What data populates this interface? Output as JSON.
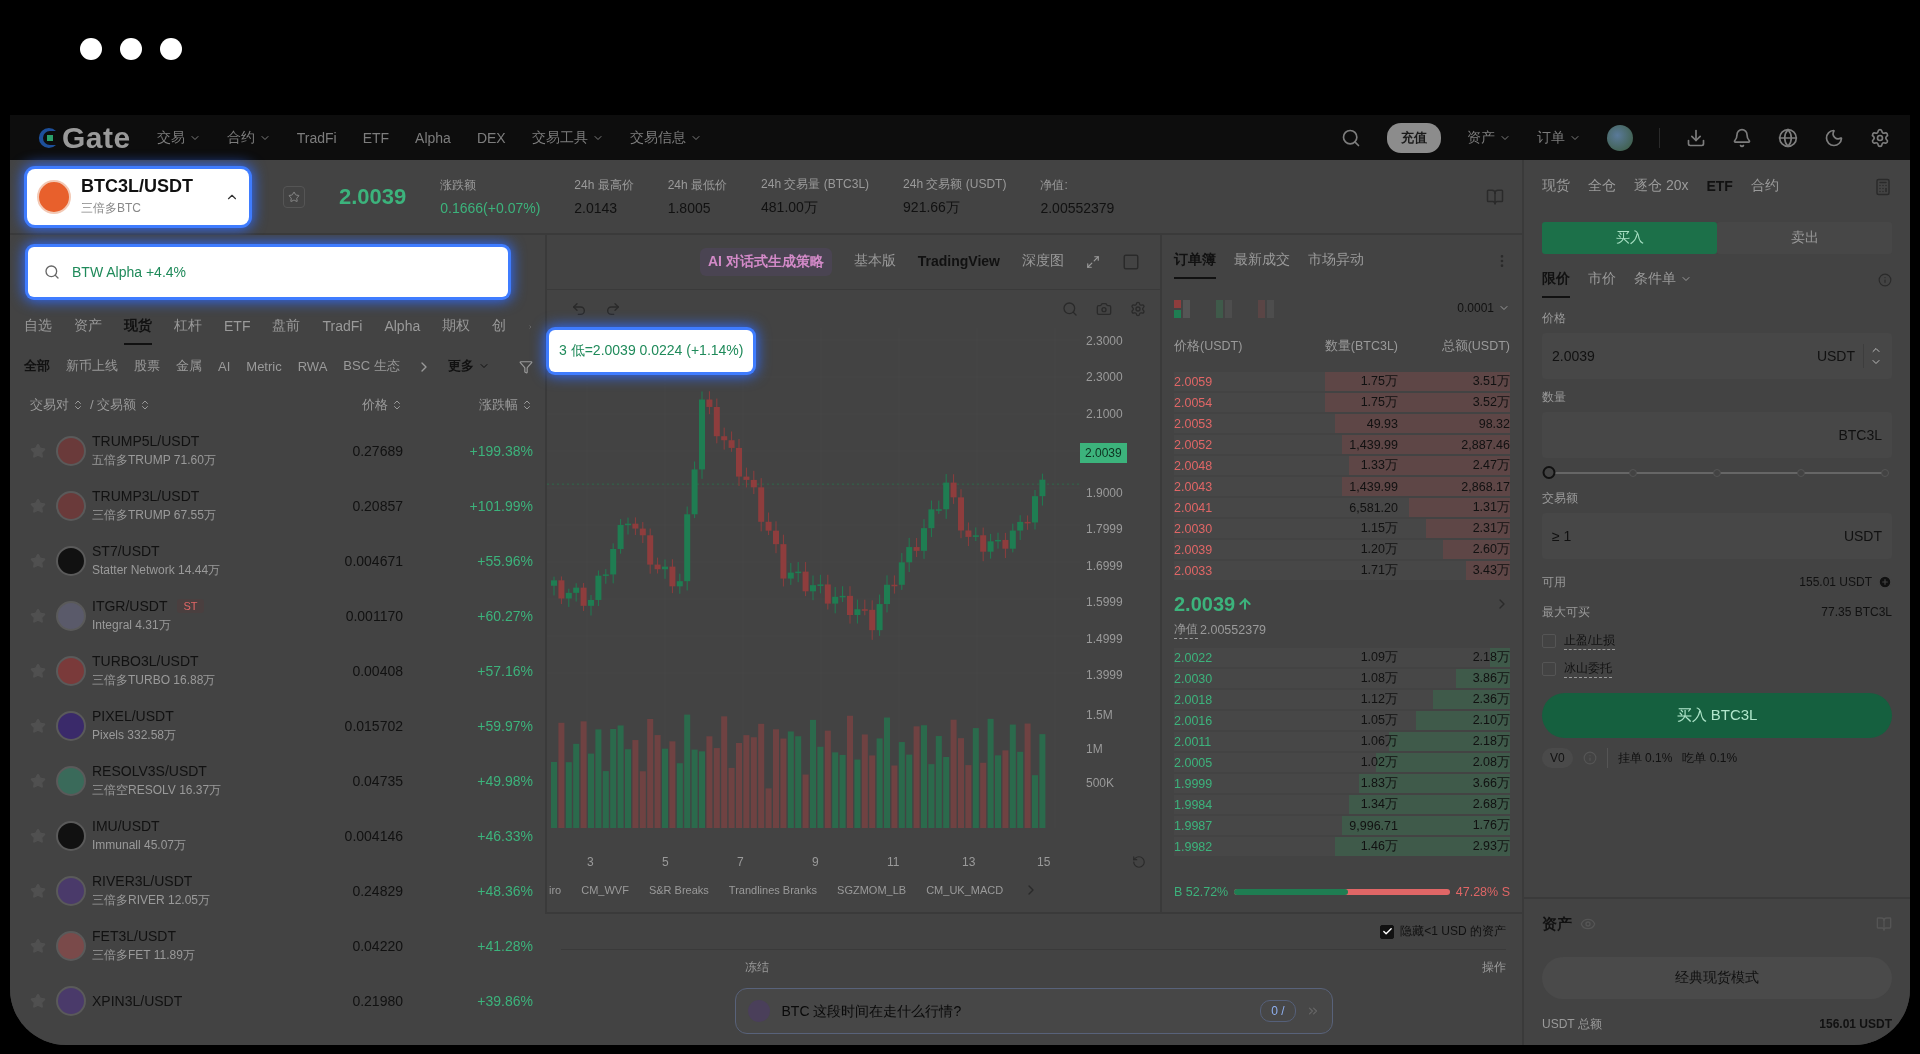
{
  "nav": {
    "logo": "Gate",
    "menu": [
      {
        "label": "交易",
        "dropdown": true
      },
      {
        "label": "合约",
        "dropdown": true
      },
      {
        "label": "TradFi",
        "dropdown": false
      },
      {
        "label": "ETF",
        "dropdown": false
      },
      {
        "label": "Alpha",
        "dropdown": false
      },
      {
        "label": "DEX",
        "dropdown": false
      },
      {
        "label": "交易工具",
        "dropdown": true
      },
      {
        "label": "交易信息",
        "dropdown": true
      }
    ],
    "deposit": "充值",
    "account_menu": [
      {
        "label": "资产",
        "dropdown": true
      },
      {
        "label": "订单",
        "dropdown": true
      }
    ]
  },
  "ticker": {
    "pair": "BTC3L/USDT",
    "pair_sub": "三倍多BTC",
    "price": "2.0039",
    "stats": [
      {
        "label": "涨跌额",
        "value": "0.1666(+0.07%)",
        "kind": "change"
      },
      {
        "label": "24h 最高价",
        "value": "2.0143",
        "kind": "plain"
      },
      {
        "label": "24h 最低价",
        "value": "1.8005",
        "kind": "plain"
      },
      {
        "label": "24h 交易量 (BTC3L)",
        "value": "481.00万",
        "kind": "plain"
      },
      {
        "label": "24h 交易额 (USDT)",
        "value": "921.66万",
        "kind": "plain"
      },
      {
        "label": "净值:",
        "value": "2.00552379",
        "kind": "plain"
      }
    ]
  },
  "market": {
    "search": {
      "placeholder": "BTW Alpha +4.4%"
    },
    "tabs": [
      {
        "label": "自选",
        "selected": false
      },
      {
        "label": "资产",
        "selected": false
      },
      {
        "label": "现货",
        "selected": true
      },
      {
        "label": "杠杆",
        "selected": false
      },
      {
        "label": "ETF",
        "selected": false
      },
      {
        "label": "盘前",
        "selected": false
      },
      {
        "label": "TradFi",
        "selected": false
      },
      {
        "label": "Alpha",
        "selected": false
      },
      {
        "label": "期权",
        "selected": false
      },
      {
        "label": "创",
        "selected": false
      }
    ],
    "filters": [
      {
        "label": "全部",
        "selected": true
      },
      {
        "label": "新币上线",
        "selected": false
      },
      {
        "label": "股票",
        "selected": false
      },
      {
        "label": "金属",
        "selected": false
      },
      {
        "label": "AI",
        "selected": false
      },
      {
        "label": "Metric",
        "selected": false
      },
      {
        "label": "RWA",
        "selected": false
      },
      {
        "label": "BSC 生态",
        "selected": false
      }
    ],
    "more": "更多",
    "columns": [
      "交易对",
      "/ 交易额",
      "价格",
      "涨跌幅"
    ],
    "rows": [
      {
        "pair": "TRUMP5L/USDT",
        "sub": "五倍多TRUMP 71.60万",
        "price": "0.27689",
        "change": "+199.38%"
      },
      {
        "pair": "TRUMP3L/USDT",
        "sub": "三倍多TRUMP 67.55万",
        "price": "0.20857",
        "change": "+101.99%"
      },
      {
        "pair": "ST7/USDT",
        "sub": "Statter Network 14.44万",
        "price": "0.004671",
        "change": "+55.96%"
      },
      {
        "pair": "ITGR/USDT",
        "tag": "ST",
        "sub": "Integral 4.31万",
        "price": "0.001170",
        "change": "+60.27%"
      },
      {
        "pair": "TURBO3L/USDT",
        "sub": "三倍多TURBO 16.88万",
        "price": "0.00408",
        "change": "+57.16%"
      },
      {
        "pair": "PIXEL/USDT",
        "sub": "Pixels 332.58万",
        "price": "0.015702",
        "change": "+59.97%"
      },
      {
        "pair": "RESOLV3S/USDT",
        "sub": "三倍空RESOLV 16.37万",
        "price": "0.04735",
        "change": "+49.98%"
      },
      {
        "pair": "IMU/USDT",
        "sub": "Immunall 45.07万",
        "price": "0.004146",
        "change": "+46.33%"
      },
      {
        "pair": "RIVER3L/USDT",
        "sub": "三倍多RIVER 12.05万",
        "price": "0.24829",
        "change": "+48.36%"
      },
      {
        "pair": "FET3L/USDT",
        "sub": "三倍多FET 11.89万",
        "price": "0.04220",
        "change": "+41.28%"
      },
      {
        "pair": "XPIN3L/USDT",
        "price": "0.21980",
        "change": "+39.86%"
      }
    ]
  },
  "chart": {
    "modes": [
      {
        "label": "AI 对话式生成策略",
        "kind": "ai",
        "selected": false
      },
      {
        "label": "基本版",
        "kind": "tab",
        "selected": false
      },
      {
        "label": "TradingView",
        "kind": "tab",
        "selected": true
      },
      {
        "label": "深度图",
        "kind": "tab",
        "selected": false
      }
    ],
    "legend": "3 低=2.0039 0.0224 (+1.14%)",
    "price_axis": [
      {
        "label": "2.3000",
        "kind": "tick"
      },
      {
        "label": "2.3000",
        "kind": "tick"
      },
      {
        "label": "2.1000",
        "kind": "tick"
      },
      {
        "label": "2.0039",
        "kind": "current"
      },
      {
        "label": "1.9000",
        "kind": "tick"
      },
      {
        "label": "1.7999",
        "kind": "tick"
      },
      {
        "label": "1.6999",
        "kind": "tick"
      },
      {
        "label": "1.5999",
        "kind": "tick"
      },
      {
        "label": "1.4999",
        "kind": "tick"
      },
      {
        "label": "1.3999",
        "kind": "tick"
      }
    ],
    "volume_axis": [
      "1.5M",
      "1M",
      "500K"
    ],
    "x_axis": [
      "3",
      "5",
      "7",
      "9",
      "11",
      "13",
      "15"
    ],
    "indicators": [
      "iro",
      "CM_WVF",
      "S&R Breaks",
      "Trandlines Branks",
      "SGZMOM_LB",
      "CM_UK_MACD"
    ]
  },
  "orderbook": {
    "tabs": [
      {
        "label": "订单簿",
        "selected": true
      },
      {
        "label": "最新成交",
        "selected": false
      },
      {
        "label": "市场异动",
        "selected": false
      }
    ],
    "precision": "0.0001",
    "columns": [
      "价格(USDT)",
      "数量(BTC3L)",
      "总额(USDT)"
    ],
    "asks": [
      {
        "price": "2.0059",
        "amount": "1.75万",
        "total": "3.51万",
        "level": 0.55
      },
      {
        "price": "2.0054",
        "amount": "1.75万",
        "total": "3.52万",
        "level": 0.55
      },
      {
        "price": "2.0053",
        "amount": "49.93",
        "total": "98.32",
        "level": 0.52
      },
      {
        "price": "2.0052",
        "amount": "1,439.99",
        "total": "2,887.46",
        "level": 0.5
      },
      {
        "price": "2.0048",
        "amount": "1.33万",
        "total": "2.47万",
        "level": 0.48
      },
      {
        "price": "2.0043",
        "amount": "1,439.99",
        "total": "2,868.17",
        "level": 0.5
      },
      {
        "price": "2.0041",
        "amount": "6,581.20",
        "total": "1.31万",
        "level": 0.3
      },
      {
        "price": "2.0030",
        "amount": "1.15万",
        "total": "2.31万",
        "level": 0.25
      },
      {
        "price": "2.0039",
        "amount": "1.20万",
        "total": "2.60万",
        "level": 0.2
      },
      {
        "price": "2.0033",
        "amount": "1.71万",
        "total": "3.43万",
        "level": 0.13
      }
    ],
    "mid_price": "2.0039",
    "nav_label": "净值",
    "nav_value": "2.00552379",
    "bids": [
      {
        "price": "2.0022",
        "amount": "1.09万",
        "total": "2.18万",
        "level": 0.06
      },
      {
        "price": "2.0030",
        "amount": "1.08万",
        "total": "3.86万",
        "level": 0.16
      },
      {
        "price": "2.0018",
        "amount": "1.12万",
        "total": "2.36万",
        "level": 0.23
      },
      {
        "price": "2.0016",
        "amount": "1.05万",
        "total": "2.10万",
        "level": 0.28
      },
      {
        "price": "2.0011",
        "amount": "1.06万",
        "total": "2.18万",
        "level": 0.36
      },
      {
        "price": "2.0005",
        "amount": "1.02万",
        "total": "2.08万",
        "level": 0.4
      },
      {
        "price": "1.9999",
        "amount": "1.83万",
        "total": "3.66万",
        "level": 0.45
      },
      {
        "price": "1.9984",
        "amount": "1.34万",
        "total": "2.68万",
        "level": 0.48
      },
      {
        "price": "1.9987",
        "amount": "9,996.71",
        "total": "1.76万",
        "level": 0.5
      },
      {
        "price": "1.9982",
        "amount": "1.46万",
        "total": "2.93万",
        "level": 0.52
      }
    ],
    "ratio": {
      "buy_label": "B 52.72%",
      "sell_label": "47.28% S",
      "level": 0.5272
    }
  },
  "bottom": {
    "hide_small": {
      "label": "隐藏<1 USD 的资产",
      "checked": true
    },
    "columns": [
      "冻结",
      "操作"
    ],
    "chat": {
      "placeholder": "BTC 这段时间在走什么行情?",
      "counter": "0 /"
    }
  },
  "trade": {
    "tabs": [
      {
        "label": "现货",
        "selected": false
      },
      {
        "label": "全仓",
        "selected": false
      },
      {
        "label": "逐仓 20x",
        "selected": false
      },
      {
        "label": "ETF",
        "selected": true
      },
      {
        "label": "合约",
        "selected": false
      }
    ],
    "sides": [
      {
        "label": "买入",
        "kind": "buy",
        "selected": true
      },
      {
        "label": "卖出",
        "kind": "sell",
        "selected": false
      }
    ],
    "order_types": [
      {
        "label": "限价",
        "selected": true,
        "dropdown": false
      },
      {
        "label": "市价",
        "selected": false,
        "dropdown": false
      },
      {
        "label": "条件单",
        "selected": false,
        "dropdown": true
      }
    ],
    "price": {
      "label": "价格",
      "value": "2.0039",
      "unit": "USDT"
    },
    "amount": {
      "label": "数量",
      "unit": "BTC3L"
    },
    "slider": {
      "level": 0
    },
    "total": {
      "label": "交易额",
      "placeholder": "≥ 1",
      "unit": "USDT"
    },
    "info": [
      {
        "label": "可用",
        "value": "155.01 USDT",
        "kind": "add"
      },
      {
        "label": "最大可买",
        "value": "77.35 BTC3L",
        "kind": "plain"
      }
    ],
    "options": [
      {
        "label": "止盈/止损",
        "checked": false
      },
      {
        "label": "冰山委托",
        "checked": false
      }
    ],
    "submit": "买入 BTC3L",
    "tier": "V0",
    "fees": [
      "挂单 0.1%",
      "吃单 0.1%"
    ]
  },
  "assets": {
    "title": "资产",
    "mode_button": "经典现货模式",
    "total_label": "USDT 总额",
    "total": "156.01 USDT"
  }
}
